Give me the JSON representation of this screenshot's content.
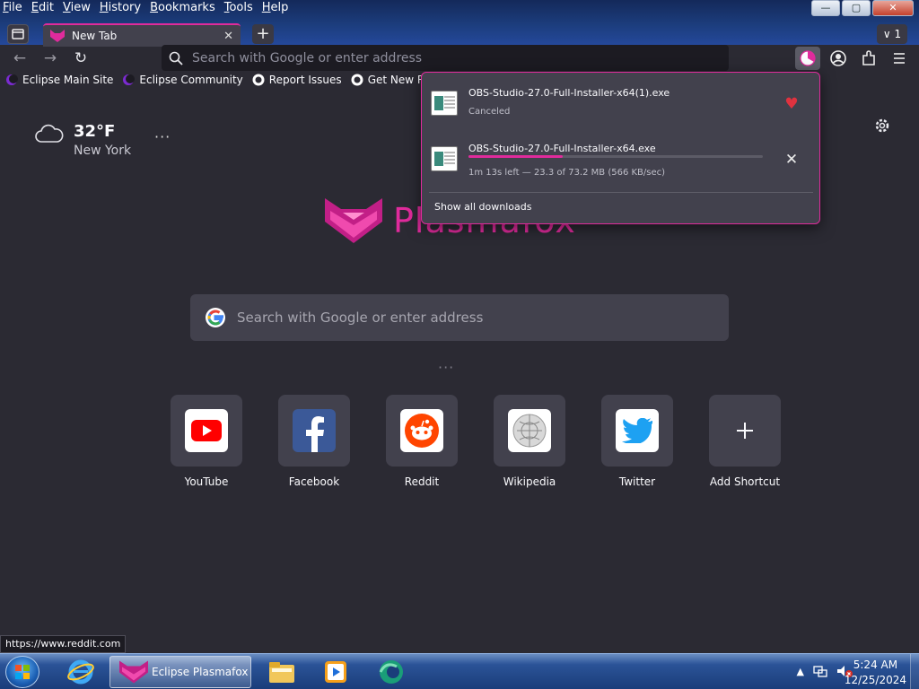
{
  "menubar": {
    "items": [
      "File",
      "Edit",
      "View",
      "History",
      "Bookmarks",
      "Tools",
      "Help"
    ]
  },
  "window_controls": {
    "minimize": "—",
    "maximize": "▢",
    "close": "✕"
  },
  "tab": {
    "title": "New Tab",
    "close": "✕",
    "new_tab": "+",
    "tabs_count": "∨ 1"
  },
  "navbar": {
    "back": "←",
    "forward": "→",
    "reload": "↻",
    "url_placeholder": "Search with Google or enter address"
  },
  "bookmarks": [
    {
      "label": "Eclipse Main Site",
      "icon": "eclipse-icon"
    },
    {
      "label": "Eclipse Community",
      "icon": "eclipse-icon"
    },
    {
      "label": "Report Issues",
      "icon": "github-icon"
    },
    {
      "label": "Get New Releases",
      "icon": "github-icon"
    }
  ],
  "weather": {
    "temperature": "32°F",
    "location": "New York",
    "more": "···"
  },
  "logo": {
    "text": "Plasmafox"
  },
  "search": {
    "placeholder": "Search with Google or enter address"
  },
  "shortcuts_dots": "···",
  "shortcuts": [
    {
      "label": "YouTube",
      "icon": "youtube-icon",
      "color": "#ff0000"
    },
    {
      "label": "Facebook",
      "icon": "facebook-icon",
      "color": "#3b5998"
    },
    {
      "label": "Reddit",
      "icon": "reddit-icon",
      "color": "#ff4500"
    },
    {
      "label": "Wikipedia",
      "icon": "wikipedia-icon",
      "color": "#000000"
    },
    {
      "label": "Twitter",
      "icon": "twitter-icon",
      "color": "#1da1f2"
    },
    {
      "label": "Add Shortcut",
      "icon": "plus-icon",
      "color": "#ffffff"
    }
  ],
  "downloads": {
    "items": [
      {
        "filename": "OBS-Studio-27.0-Full-Installer-x64(1).exe",
        "status": "Canceled",
        "action": "retry",
        "action_icon": "♥"
      },
      {
        "filename": "OBS-Studio-27.0-Full-Installer-x64.exe",
        "status": "1m 13s left — 23.3 of 73.2 MB (566 KB/sec)",
        "progress": 0.32,
        "action": "cancel",
        "action_icon": "✕"
      }
    ],
    "show_all": "Show all downloads"
  },
  "status_url": "https://www.reddit.com",
  "taskbar": {
    "active_app": "Eclipse Plasmafox",
    "time": "5:24 AM",
    "date": "12/25/2024",
    "tray_arrow": "▲"
  },
  "colors": {
    "accent": "#e02b9c",
    "background": "#2b2a33",
    "panel": "#42414d"
  }
}
